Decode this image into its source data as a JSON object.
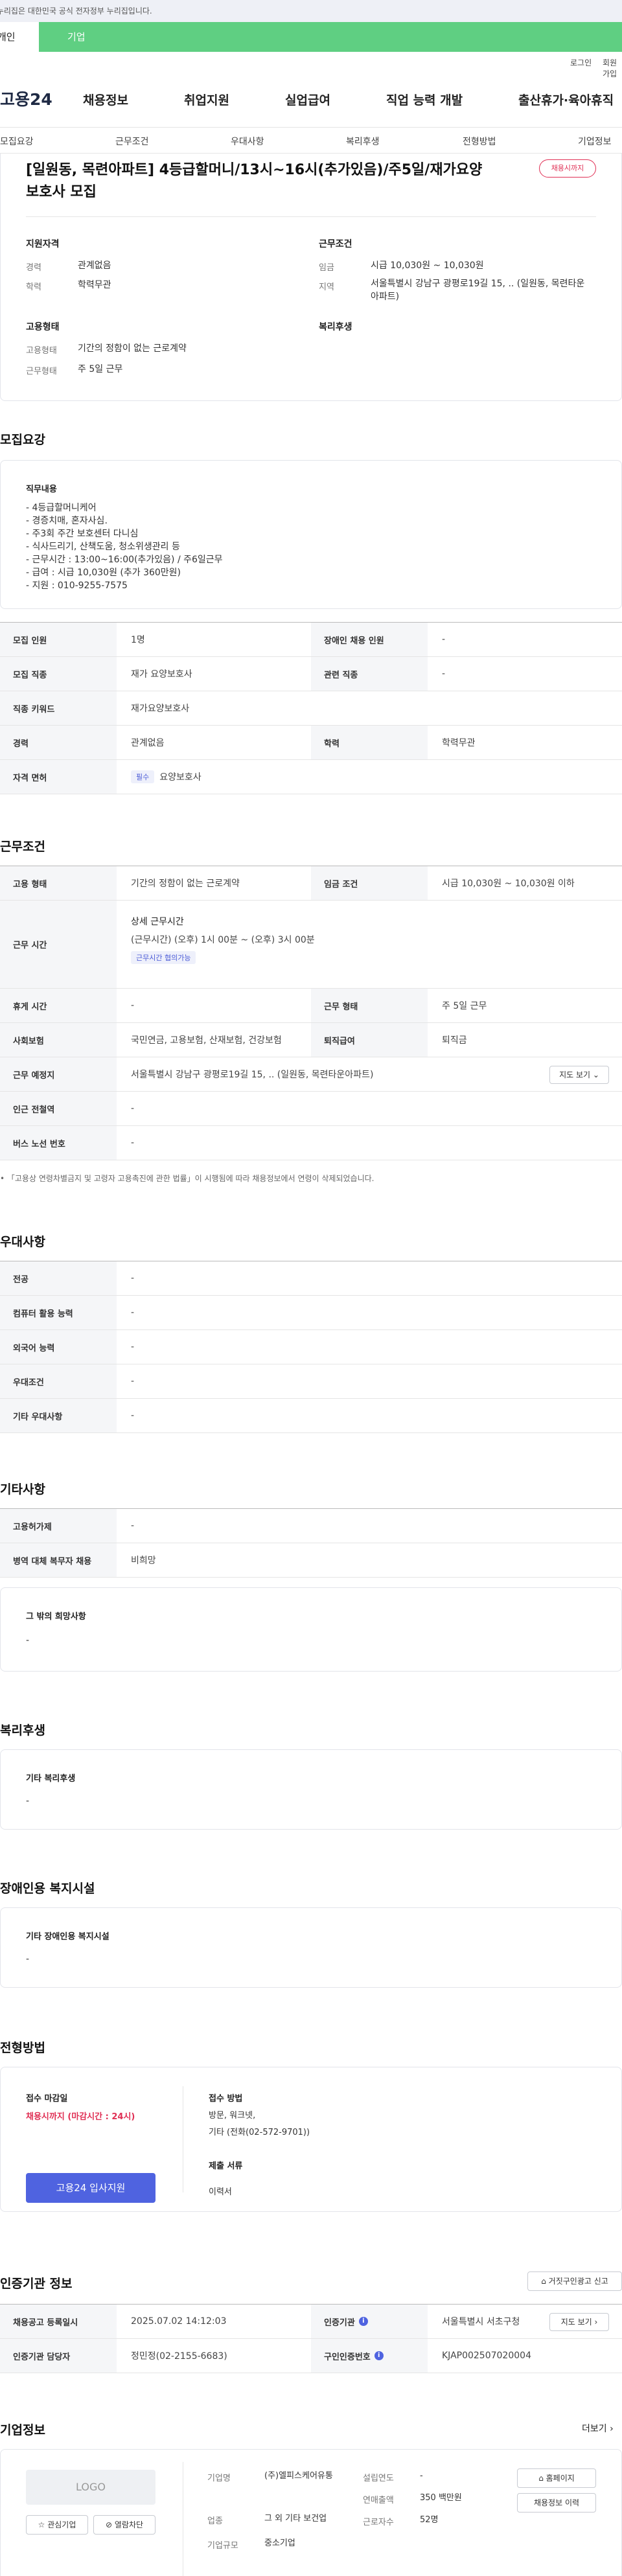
{
  "topbar": {
    "notice": "이 누리집은 대한민국 공식 전자정부 누리집입니다."
  },
  "member_tabs": {
    "personal": "개인",
    "company": "기업"
  },
  "util": {
    "login": "로그인",
    "signup": "회원가입"
  },
  "gnb": {
    "logo": "고용24",
    "items": [
      "채용정보",
      "취업지원",
      "실업급여",
      "직업 능력 개발",
      "출산휴가·육아휴직"
    ]
  },
  "subnav": [
    "모집요강",
    "근무조건",
    "우대사항",
    "복리후생",
    "전형방법",
    "기업정보"
  ],
  "summary": {
    "title": "[일원동, 목련아파트] 4등급할머니/13시~16시(추가있음)/주5일/재가요양보호사 모집",
    "status": "채용시까지",
    "qual_heading": "지원자격",
    "career_label": "경력",
    "career_value": "관계없음",
    "edu_label": "학력",
    "edu_value": "학력무관",
    "cond_heading": "근무조건",
    "wage_label": "임금",
    "wage_value": "시급 10,030원 ~ 10,030원",
    "loc_label": "지역",
    "loc_value": "서울특별시 강남구 광평로19길 15, .. (일원동, 목련타운아파트)",
    "emp_heading": "고용형태",
    "emptype_label": "고용형태",
    "emptype_value": "기간의 정함이 없는 근로계약",
    "worktype_label": "근무형태",
    "worktype_value": "주 5일 근무",
    "welfare_heading": "복리후생"
  },
  "recruit": {
    "title": "모집요강",
    "duty_heading": "직무내용",
    "duty_lines": [
      "- 4등급할머니케어",
      "- 경증치매, 혼자사심.",
      "- 주3회 주간 보호센터 다니심",
      "- 식사드리기, 산책도움, 청소위생관리 등",
      "- 근무시간 : 13:00~16:00(추가있음) / 주6일근무",
      "- 급여 : 시급 10,030원 (추가 360만원)",
      "- 지원 : 010-9255-7575"
    ],
    "rows": [
      {
        "l1": "모집 인원",
        "v1": "1명",
        "l2": "장애인 채용 인원",
        "v2": "-"
      },
      {
        "l1": "모집 직종",
        "v1": "재가 요양보호사",
        "l2": "관련 직종",
        "v2": "-"
      },
      {
        "l1": "직종 키워드",
        "v1": "재가요양보호사"
      },
      {
        "l1": "경력",
        "v1": "관계없음",
        "l2": "학력",
        "v2": "학력무관"
      },
      {
        "l1": "자격 면허",
        "chip": "필수",
        "v1": "요양보호사"
      }
    ]
  },
  "conditions": {
    "title": "근무조건",
    "emp_label": "고용 형태",
    "emp_value": "기간의 정함이 없는 근로계약",
    "wage_label": "임금 조건",
    "wage_value": "시급 10,030원 ~ 10,030원 이하",
    "time_label": "근무 시간",
    "time_head": "상세 근무시간",
    "time_value": "(근무시간) (오후) 1시 00분 ~ (오후) 3시 00분",
    "time_chip": "근무시간 협의가능",
    "holiday_label": "휴게 시간",
    "holiday_value": "-",
    "worktype_label": "근무 형태",
    "worktype_value": "주 5일 근무",
    "insurance_label": "사회보험",
    "insurance_value": "국민연금, 고용보험, 산재보험, 건강보험",
    "severance_label": "퇴직급여",
    "severance_value": "퇴직금",
    "place_label": "근무 예정지",
    "place_value": "서울특별시 강남구 광평로19길 15, .. (일원동, 목련타운아파트)",
    "map_btn": "지도 보기 ⌄",
    "subway_label": "인근 전철역",
    "subway_value": "-",
    "bus_label": "버스 노선 번호",
    "bus_value": "-",
    "note": "• 「고용상 연령차별금지 및 고령자 고용촉진에 관한 법률」이 시행됨에 따라 채용정보에서 연령이 삭제되었습니다."
  },
  "preference": {
    "title": "우대사항",
    "rows": [
      {
        "l": "전공",
        "v": "-"
      },
      {
        "l": "컴퓨터 활용 능력",
        "v": "-"
      },
      {
        "l": "외국어 능력",
        "v": "-"
      },
      {
        "l": "우대조건",
        "v": "-"
      },
      {
        "l": "기타 우대사항",
        "v": "-"
      }
    ]
  },
  "etc": {
    "title": "기타사항",
    "rows": [
      {
        "l": "고용허가제",
        "v": "-"
      },
      {
        "l": "병역 대체 복무자 채용",
        "v": "비희망"
      }
    ],
    "other_heading": "그 밖의 희망사항",
    "other_value": "-"
  },
  "welfare": {
    "title": "복리후생",
    "heading": "기타 복리후생",
    "value": "-"
  },
  "disability": {
    "title": "장애인용 복지시설",
    "heading": "기타 장애인용 복지시설",
    "value": "-"
  },
  "selection": {
    "title": "전형방법",
    "deadline_heading": "접수 마감일",
    "deadline_value": "채용시까지 (마감시간 : 24시)",
    "apply_btn": "고용24 입사지원",
    "method_heading": "접수 방법",
    "method_value1": "방문, 워크넷,",
    "method_value2": "기타 (전화(02-572-9701))",
    "docs_heading": "제출 서류",
    "docs_value": "이력서"
  },
  "agency": {
    "title": "인증기관 정보",
    "report_btn": "거짓구인광고 신고",
    "reg_label": "채용공고 등록일시",
    "reg_value": "2025.07.02 14:12:03",
    "org_label": "인증기관",
    "org_value": "서울특별시 서초구청",
    "map_btn": "지도 보기",
    "mgr_label": "인증기관 담당자",
    "mgr_value": "정민정(02-2155-6683)",
    "cert_label": "구인인증번호",
    "cert_value": "KJAP002507020004"
  },
  "company": {
    "title": "기업정보",
    "more": "더보기",
    "logo": "LOGO",
    "fav_btn": "관심기업",
    "block_btn": "열람차단",
    "name_label": "기업명",
    "name_value": "(주)엘피스케어유통",
    "industry_label": "업종",
    "industry_value": "그 외 기타 보건업",
    "size_label": "기업규모",
    "size_value": "중소기업",
    "year_label": "설립연도",
    "year_value": "-",
    "sales_label": "연매출액",
    "sales_value": "350 백만원",
    "emp_label": "근로자수",
    "emp_value": "52명",
    "home_btn": "홈페이지",
    "history_btn": "채용정보 이력"
  }
}
